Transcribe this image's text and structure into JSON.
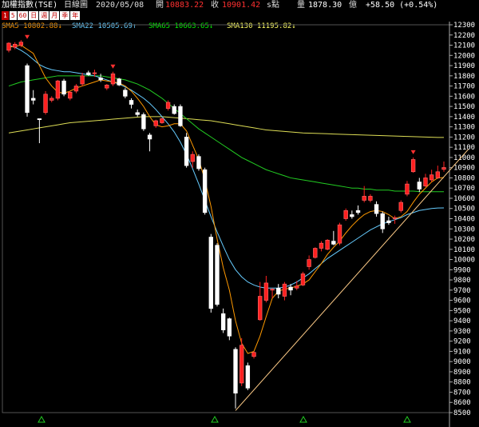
{
  "header": {
    "title": "加權指數(TSE)",
    "period": "日線圖",
    "date": "2020/05/08",
    "open_label": "開",
    "open": "10883.22",
    "close_label": "收",
    "close": "10901.42",
    "close_flag": "s點",
    "volume_label": "量",
    "volume": "1878.30",
    "volume_unit": "億",
    "change": "+58.50 (+0.54%)"
  },
  "periods": [
    {
      "label": "1",
      "active": true
    },
    {
      "label": "5",
      "active": false
    },
    {
      "label": "60",
      "active": false
    },
    {
      "label": "日",
      "active": false
    },
    {
      "label": "週",
      "active": false
    },
    {
      "label": "月",
      "active": false
    },
    {
      "label": "季",
      "active": false
    },
    {
      "label": "年",
      "active": false
    }
  ],
  "legend": [
    {
      "text": "SMA5 10802.88↓",
      "color": "#ff9900"
    },
    {
      "text": "SMA22 10505.69↑",
      "color": "#66ccff"
    },
    {
      "text": "SMA65 10663.65↓",
      "color": "#00ee00"
    },
    {
      "text": "SMA130 11195.82↓",
      "color": "#ffff66"
    }
  ],
  "colors": {
    "up": "#ff2020",
    "down": "#ffffff",
    "sma5": "#ff9900",
    "sma22": "#66ccff",
    "sma65": "#22cc22",
    "sma130": "#dddd55",
    "trendline": "#ffcc88",
    "grid": "#3a3a3a"
  },
  "chart_data": {
    "type": "candlestick",
    "ylim": [
      8500,
      12300
    ],
    "y_ticks": [
      12300,
      12200,
      12100,
      12000,
      11900,
      11800,
      11700,
      11600,
      11500,
      11400,
      11300,
      11200,
      11100,
      11000,
      10900,
      10800,
      10700,
      10600,
      10500,
      10400,
      10300,
      10200,
      10100,
      10000,
      9900,
      9800,
      9700,
      9600,
      9500,
      9400,
      9300,
      9200,
      9100,
      9000,
      8900,
      8800,
      8700,
      8600,
      8500
    ],
    "candles": [
      {
        "o": 12050,
        "h": 12130,
        "l": 12030,
        "c": 12120
      },
      {
        "o": 12080,
        "h": 12130,
        "l": 12060,
        "c": 12110
      },
      {
        "o": 12100,
        "h": 12150,
        "l": 12080,
        "c": 12130
      },
      {
        "o": 11900,
        "h": 11920,
        "l": 11400,
        "c": 11440
      },
      {
        "o": 11580,
        "h": 11660,
        "l": 11520,
        "c": 11560
      },
      {
        "o": 11380,
        "h": 11380,
        "l": 11140,
        "c": 11370
      },
      {
        "o": 11440,
        "h": 11650,
        "l": 11420,
        "c": 11620
      },
      {
        "o": 11560,
        "h": 11600,
        "l": 11540,
        "c": 11580
      },
      {
        "o": 11580,
        "h": 11760,
        "l": 11560,
        "c": 11750
      },
      {
        "o": 11750,
        "h": 11770,
        "l": 11600,
        "c": 11620
      },
      {
        "o": 11580,
        "h": 11650,
        "l": 11560,
        "c": 11640
      },
      {
        "o": 11650,
        "h": 11720,
        "l": 11630,
        "c": 11700
      },
      {
        "o": 11720,
        "h": 11830,
        "l": 11700,
        "c": 11800
      },
      {
        "o": 11830,
        "h": 11850,
        "l": 11800,
        "c": 11810
      },
      {
        "o": 11820,
        "h": 11860,
        "l": 11790,
        "c": 11830
      },
      {
        "o": 11780,
        "h": 11820,
        "l": 11740,
        "c": 11760
      },
      {
        "o": 11680,
        "h": 11720,
        "l": 11660,
        "c": 11710
      },
      {
        "o": 11720,
        "h": 11840,
        "l": 11700,
        "c": 11820
      },
      {
        "o": 11770,
        "h": 11780,
        "l": 11700,
        "c": 11710
      },
      {
        "o": 11660,
        "h": 11680,
        "l": 11580,
        "c": 11600
      },
      {
        "o": 11560,
        "h": 11580,
        "l": 11480,
        "c": 11520
      },
      {
        "o": 11440,
        "h": 11470,
        "l": 11400,
        "c": 11420
      },
      {
        "o": 11420,
        "h": 11440,
        "l": 11260,
        "c": 11280
      },
      {
        "o": 11220,
        "h": 11240,
        "l": 11060,
        "c": 11180
      },
      {
        "o": 11310,
        "h": 11370,
        "l": 11290,
        "c": 11360
      },
      {
        "o": 11340,
        "h": 11390,
        "l": 11330,
        "c": 11380
      },
      {
        "o": 11480,
        "h": 11560,
        "l": 11460,
        "c": 11540
      },
      {
        "o": 11500,
        "h": 11520,
        "l": 11420,
        "c": 11430
      },
      {
        "o": 11500,
        "h": 11520,
        "l": 11300,
        "c": 11310
      },
      {
        "o": 11200,
        "h": 11240,
        "l": 10900,
        "c": 10920
      },
      {
        "o": 10960,
        "h": 11060,
        "l": 10900,
        "c": 11030
      },
      {
        "o": 11010,
        "h": 11030,
        "l": 10870,
        "c": 10890
      },
      {
        "o": 10880,
        "h": 10900,
        "l": 10440,
        "c": 10460
      },
      {
        "o": 10220,
        "h": 10250,
        "l": 9480,
        "c": 9520
      },
      {
        "o": 10140,
        "h": 10160,
        "l": 9540,
        "c": 9560
      },
      {
        "o": 9470,
        "h": 9520,
        "l": 9280,
        "c": 9310
      },
      {
        "o": 9420,
        "h": 9430,
        "l": 9210,
        "c": 9250
      },
      {
        "o": 9120,
        "h": 9140,
        "l": 8540,
        "c": 8690
      },
      {
        "o": 8790,
        "h": 9230,
        "l": 8760,
        "c": 9160
      },
      {
        "o": 8960,
        "h": 8990,
        "l": 8720,
        "c": 8740
      },
      {
        "o": 9050,
        "h": 9100,
        "l": 9030,
        "c": 9090
      },
      {
        "o": 9410,
        "h": 9780,
        "l": 9400,
        "c": 9640
      },
      {
        "o": 9600,
        "h": 9840,
        "l": 9580,
        "c": 9770
      },
      {
        "o": 9700,
        "h": 9720,
        "l": 9620,
        "c": 9710
      },
      {
        "o": 9720,
        "h": 9760,
        "l": 9620,
        "c": 9660
      },
      {
        "o": 9640,
        "h": 9780,
        "l": 9600,
        "c": 9760
      },
      {
        "o": 9730,
        "h": 9760,
        "l": 9650,
        "c": 9700
      },
      {
        "o": 9720,
        "h": 9790,
        "l": 9700,
        "c": 9740
      },
      {
        "o": 9750,
        "h": 9880,
        "l": 9740,
        "c": 9860
      },
      {
        "o": 9930,
        "h": 10040,
        "l": 9900,
        "c": 10000
      },
      {
        "o": 10020,
        "h": 10120,
        "l": 10010,
        "c": 10110
      },
      {
        "o": 10110,
        "h": 10180,
        "l": 10080,
        "c": 10160
      },
      {
        "o": 10100,
        "h": 10200,
        "l": 10090,
        "c": 10190
      },
      {
        "o": 10180,
        "h": 10280,
        "l": 10140,
        "c": 10150
      },
      {
        "o": 10160,
        "h": 10360,
        "l": 10140,
        "c": 10340
      },
      {
        "o": 10400,
        "h": 10500,
        "l": 10380,
        "c": 10480
      },
      {
        "o": 10440,
        "h": 10480,
        "l": 10400,
        "c": 10420
      },
      {
        "o": 10480,
        "h": 10530,
        "l": 10440,
        "c": 10460
      },
      {
        "o": 10580,
        "h": 10720,
        "l": 10560,
        "c": 10620
      },
      {
        "o": 10580,
        "h": 10640,
        "l": 10560,
        "c": 10620
      },
      {
        "o": 10540,
        "h": 10570,
        "l": 10420,
        "c": 10450
      },
      {
        "o": 10450,
        "h": 10470,
        "l": 10260,
        "c": 10300
      },
      {
        "o": 10380,
        "h": 10420,
        "l": 10340,
        "c": 10360
      },
      {
        "o": 10400,
        "h": 10430,
        "l": 10350,
        "c": 10410
      },
      {
        "o": 10480,
        "h": 10580,
        "l": 10460,
        "c": 10560
      },
      {
        "o": 10640,
        "h": 10770,
        "l": 10620,
        "c": 10740
      },
      {
        "o": 10860,
        "h": 11000,
        "l": 10850,
        "c": 10980
      },
      {
        "o": 10760,
        "h": 10800,
        "l": 10660,
        "c": 10690
      },
      {
        "o": 10720,
        "h": 10840,
        "l": 10710,
        "c": 10800
      },
      {
        "o": 10780,
        "h": 10880,
        "l": 10760,
        "c": 10830
      },
      {
        "o": 10800,
        "h": 10920,
        "l": 10790,
        "c": 10860
      },
      {
        "o": 10883.22,
        "h": 10960,
        "l": 10860,
        "c": 10901.42
      }
    ],
    "sma5": [
      12080,
      12090,
      12100,
      12060,
      12020,
      11900,
      11780,
      11700,
      11640,
      11630,
      11650,
      11680,
      11700,
      11720,
      11740,
      11760,
      11750,
      11740,
      11730,
      11700,
      11650,
      11580,
      11500,
      11400,
      11320,
      11300,
      11310,
      11330,
      11330,
      11260,
      11120,
      10980,
      10780,
      10520,
      10200,
      9920,
      9700,
      9400,
      9180,
      9080,
      9100,
      9250,
      9440,
      9620,
      9690,
      9710,
      9720,
      9740,
      9760,
      9800,
      9880,
      9960,
      10050,
      10120,
      10180,
      10260,
      10330,
      10390,
      10440,
      10470,
      10480,
      10470,
      10440,
      10400,
      10420,
      10470,
      10560,
      10640,
      10700,
      10760,
      10800,
      10803
    ],
    "sma22": [
      12100,
      12080,
      12050,
      12010,
      11960,
      11910,
      11880,
      11860,
      11850,
      11840,
      11840,
      11830,
      11820,
      11810,
      11800,
      11780,
      11760,
      11740,
      11720,
      11690,
      11660,
      11620,
      11580,
      11530,
      11470,
      11400,
      11330,
      11250,
      11150,
      11030,
      10890,
      10740,
      10580,
      10420,
      10270,
      10130,
      10000,
      9900,
      9830,
      9780,
      9750,
      9730,
      9720,
      9720,
      9720,
      9730,
      9750,
      9780,
      9820,
      9860,
      9910,
      9960,
      10010,
      10050,
      10090,
      10130,
      10170,
      10210,
      10250,
      10290,
      10320,
      10350,
      10370,
      10390,
      10410,
      10440,
      10460,
      10480,
      10490,
      10500,
      10505,
      10506
    ],
    "sma65": [
      11700,
      11720,
      11740,
      11750,
      11760,
      11770,
      11780,
      11790,
      11800,
      11800,
      11800,
      11800,
      11800,
      11800,
      11800,
      11800,
      11790,
      11780,
      11770,
      11760,
      11740,
      11720,
      11690,
      11660,
      11620,
      11580,
      11530,
      11480,
      11430,
      11380,
      11330,
      11280,
      11240,
      11200,
      11160,
      11120,
      11080,
      11040,
      11000,
      10970,
      10940,
      10910,
      10880,
      10860,
      10840,
      10820,
      10800,
      10790,
      10780,
      10770,
      10760,
      10750,
      10740,
      10730,
      10720,
      10710,
      10700,
      10700,
      10690,
      10690,
      10680,
      10680,
      10680,
      10670,
      10670,
      10670,
      10670,
      10665,
      10664,
      10664,
      10664,
      10664
    ],
    "sma130": [
      11240,
      11250,
      11260,
      11270,
      11280,
      11290,
      11300,
      11310,
      11320,
      11330,
      11340,
      11345,
      11350,
      11355,
      11360,
      11365,
      11370,
      11375,
      11380,
      11385,
      11390,
      11395,
      11400,
      11400,
      11400,
      11400,
      11395,
      11390,
      11385,
      11380,
      11375,
      11370,
      11365,
      11360,
      11350,
      11340,
      11330,
      11320,
      11310,
      11300,
      11290,
      11280,
      11270,
      11265,
      11260,
      11255,
      11250,
      11245,
      11240,
      11238,
      11236,
      11234,
      11232,
      11230,
      11228,
      11226,
      11224,
      11222,
      11220,
      11218,
      11216,
      11214,
      11212,
      11210,
      11208,
      11206,
      11204,
      11202,
      11200,
      11198,
      11196,
      11196
    ],
    "trendline": {
      "from": {
        "index": 37,
        "value": 8520
      },
      "to": {
        "index": 75,
        "value": 11080
      }
    },
    "markers": [
      {
        "index": 3,
        "value": 12130
      },
      {
        "index": 17,
        "value": 11840
      },
      {
        "index": 66,
        "value": 11000
      }
    ]
  }
}
